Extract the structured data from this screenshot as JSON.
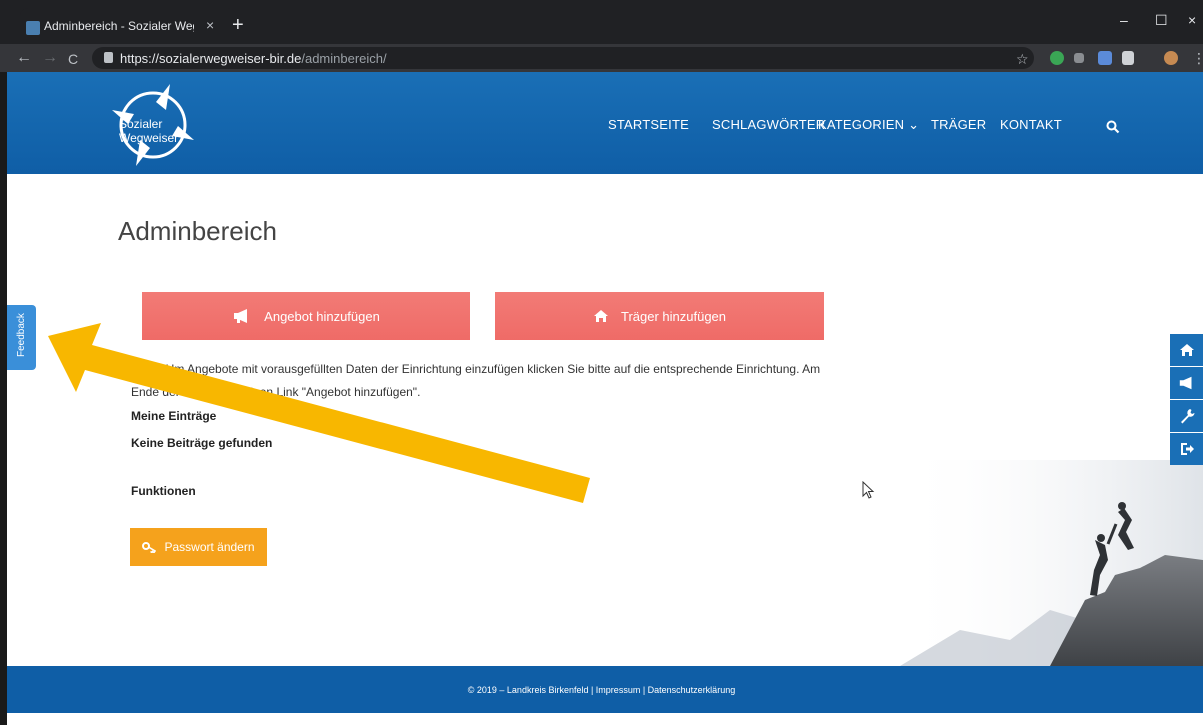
{
  "browser": {
    "tab_title": "Adminbereich - Sozialer Wegwei",
    "tab_close": "×",
    "new_tab": "+",
    "url_host": "https://sozialerwegweiser-bir.de",
    "url_path": "/adminbereich/",
    "win_min": "–",
    "win_max": "☐",
    "win_close": "×",
    "back": "←",
    "forward": "→",
    "reload": "C",
    "star": "☆"
  },
  "site": {
    "logo_line1": "Sozialer",
    "logo_line2": "Wegweiser",
    "nav": [
      {
        "label": "STARTSEITE"
      },
      {
        "label": "SCHLAGWÖRTER"
      },
      {
        "label": "KATEGORIEN ⌄"
      },
      {
        "label": "TRÄGER"
      },
      {
        "label": "KONTAKT"
      }
    ]
  },
  "main": {
    "title": "Adminbereich",
    "btn_angebot": "Angebot hinzufügen",
    "btn_traeger": "Träger hinzufügen",
    "hint_line1": "AC         E: Um Angebote mit vorausgefüllten Daten der Einrichtung einzufügen klicken Sie bitte auf die entsprechende Einrichtung. Am",
    "hint_line2": "Ende der Seite g        det einen Link \"Angebot hinzufügen\".",
    "meine_eintraege": "Meine Einträge",
    "keine_beitraege": "Keine Beiträge gefunden",
    "funktionen": "Funktionen",
    "btn_passwort": "Passwort ändern"
  },
  "feedback": {
    "label": "Feedback"
  },
  "footer": {
    "text": "© 2019 – Landkreis Birkenfeld | Impressum | Datenschutzerklärung"
  },
  "colors": {
    "header_blue": "#1a6fb6",
    "button_red": "#ef6b67",
    "button_orange": "#f5a21c",
    "arrow_yellow": "#f8b700"
  }
}
